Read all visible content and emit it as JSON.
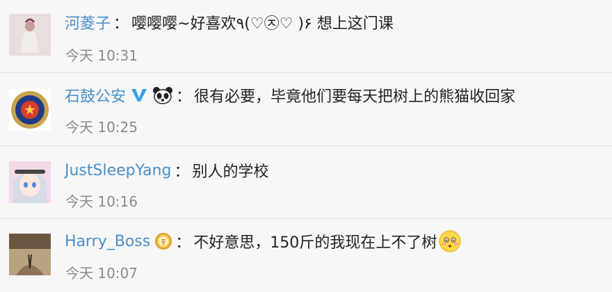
{
  "comments": [
    {
      "username": "河菱子",
      "colon": "：",
      "text": "嘤嘤嘤~好喜欢٩(♡㉨♡ )۶ 想上这门课",
      "time": "今天 10:31"
    },
    {
      "username": "石鼓公安",
      "colon": "：",
      "text": "很有必要，毕竟他们要每天把树上的熊猫收回家",
      "time": "今天 10:25",
      "badges": [
        "verified-v-icon",
        "panda-icon"
      ]
    },
    {
      "username": "JustSleepYang",
      "colon": "：",
      "text": "别人的学校",
      "time": "今天 10:16"
    },
    {
      "username": "Harry_Boss",
      "colon": "：",
      "text": "不好意思，150斤的我现在上不了树",
      "time": "今天 10:07",
      "badges": [
        "answer-medal-icon"
      ],
      "trailing_emoji": "embarrassed-face-emoji"
    }
  ],
  "colors": {
    "background": "#f7f7f7",
    "username": "#4a8fc8",
    "time": "#8a8a8a",
    "divider": "#e0e0e0",
    "verified": "#3aa0e8"
  }
}
